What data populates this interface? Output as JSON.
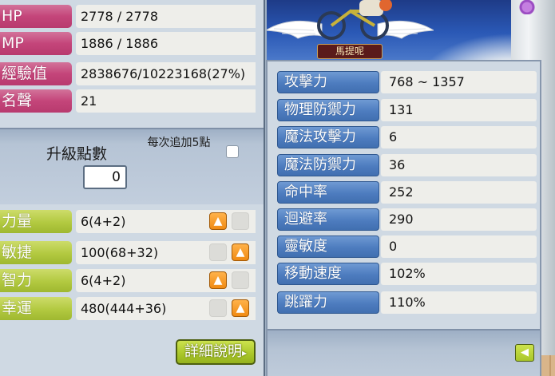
{
  "character": {
    "name": "馬提呢"
  },
  "basic": [
    {
      "label": "HP",
      "value": "2778 / 2778"
    },
    {
      "label": "MP",
      "value": "1886 / 1886"
    },
    {
      "label": "經驗值",
      "value": "2838676/10223168(27%)"
    },
    {
      "label": "名聲",
      "value": "21"
    }
  ],
  "ap": {
    "title": "升級點數",
    "value": "0",
    "auto_label": "每次追加5點",
    "auto_checked": false
  },
  "stats": [
    {
      "label": "力量",
      "value": "6(4+2)",
      "plus_enabled": true
    },
    {
      "label": "敏捷",
      "value": "100(68+32)",
      "plus_enabled": true
    },
    {
      "label": "智力",
      "value": "6(4+2)",
      "plus_enabled": true
    },
    {
      "label": "幸運",
      "value": "480(444+36)",
      "plus_enabled": true
    }
  ],
  "detail_button": {
    "label": "詳細說明"
  },
  "detail_stats": [
    {
      "label": "攻擊力",
      "value": "768 ~ 1357"
    },
    {
      "label": "物理防禦力",
      "value": "131"
    },
    {
      "label": "魔法攻擊力",
      "value": "6"
    },
    {
      "label": "魔法防禦力",
      "value": "36"
    },
    {
      "label": "命中率",
      "value": "252"
    },
    {
      "label": "迴避率",
      "value": "290"
    },
    {
      "label": "靈敏度",
      "value": "0"
    },
    {
      "label": "移動速度",
      "value": "102%"
    },
    {
      "label": "跳躍力",
      "value": "110%"
    }
  ],
  "icons": {
    "plus": "arrow-up-icon",
    "detail": "chevron-right-icon",
    "collapse": "arrow-left-icon"
  },
  "colors": {
    "panel_bg": "#cfd9e3",
    "label_pink": "#c4457a",
    "label_green": "#b2c940",
    "label_blue": "#4d7cbf",
    "plus_orange": "#f08a12"
  }
}
